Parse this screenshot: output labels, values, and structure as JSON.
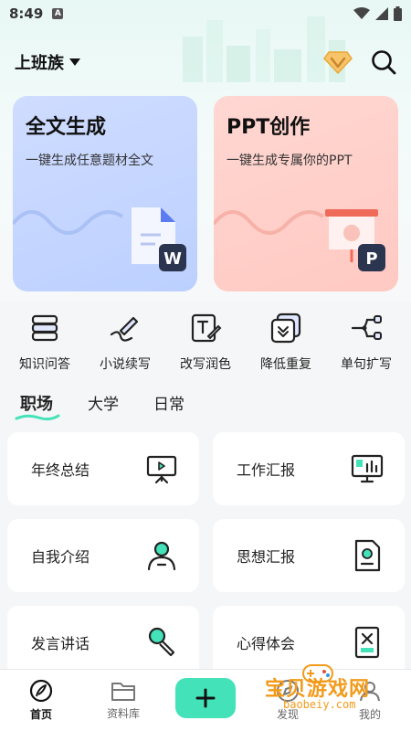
{
  "status_bar": {
    "time": "8:49",
    "notif_letter": "A"
  },
  "header": {
    "identity_label": "上班族"
  },
  "cards": [
    {
      "title": "全文生成",
      "subtitle": "一键生成任意题材全文",
      "badge": "W"
    },
    {
      "title": "PPT创作",
      "subtitle": "一键生成专属你的PPT",
      "badge": "P"
    }
  ],
  "tools": [
    {
      "label": "知识问答",
      "icon": "books-icon"
    },
    {
      "label": "小说续写",
      "icon": "pen-icon"
    },
    {
      "label": "改写润色",
      "icon": "edit-box-icon"
    },
    {
      "label": "降低重复",
      "icon": "reduce-icon"
    },
    {
      "label": "单句扩写",
      "icon": "expand-icon"
    }
  ],
  "tabs": [
    {
      "label": "职场",
      "active": true
    },
    {
      "label": "大学",
      "active": false
    },
    {
      "label": "日常",
      "active": false
    }
  ],
  "grid": [
    {
      "label": "年终总结",
      "icon": "presentation-icon"
    },
    {
      "label": "工作汇报",
      "icon": "report-board-icon"
    },
    {
      "label": "自我介绍",
      "icon": "person-icon"
    },
    {
      "label": "思想汇报",
      "icon": "document-seal-icon"
    },
    {
      "label": "发言讲话",
      "icon": "microphone-icon"
    },
    {
      "label": "心得体会",
      "icon": "note-icon"
    }
  ],
  "bottom_nav": [
    {
      "label": "首页",
      "active": true
    },
    {
      "label": "资料库",
      "active": false
    },
    {
      "label": "",
      "active": false
    },
    {
      "label": "发现",
      "active": false
    },
    {
      "label": "我的",
      "active": false
    }
  ],
  "watermark": {
    "text": "宝贝游戏网",
    "url": "baobeiy.com"
  },
  "colors": {
    "accent": "#43e2b8",
    "card_blue": "#c6d6ff",
    "card_pink": "#ffcfc9",
    "badge_dark": "#2c3550"
  }
}
